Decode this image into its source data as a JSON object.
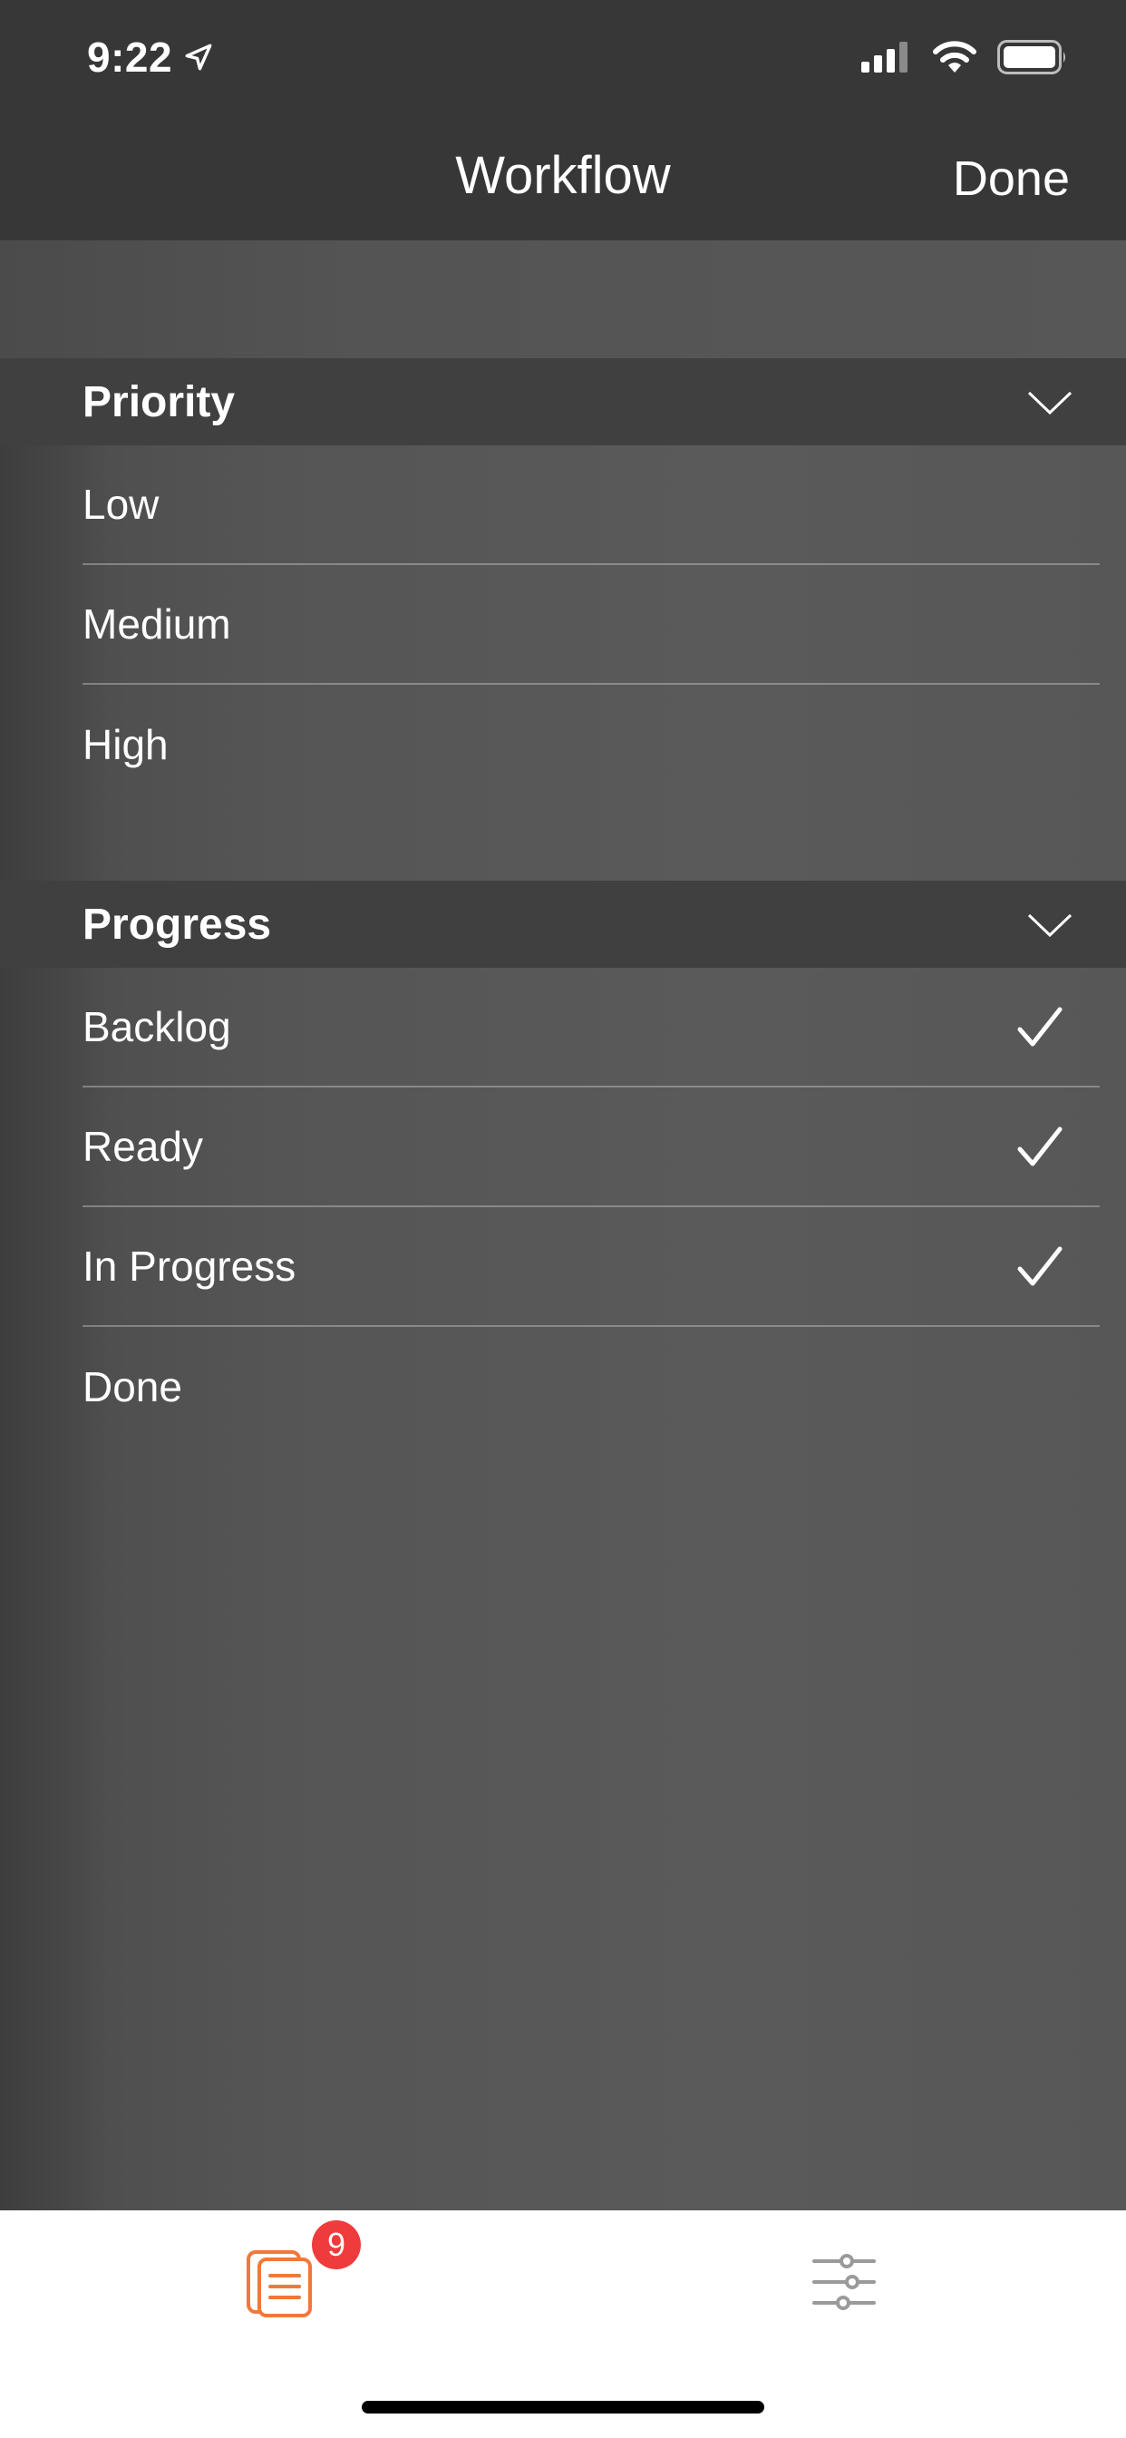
{
  "status_bar": {
    "time": "9:22",
    "icons": [
      "location-arrow-icon",
      "cellular-signal-icon",
      "wifi-icon",
      "battery-icon"
    ]
  },
  "nav": {
    "title": "Workflow",
    "done_label": "Done"
  },
  "sections": [
    {
      "title": "Priority",
      "items": [
        {
          "label": "Low",
          "checked": false
        },
        {
          "label": "Medium",
          "checked": false
        },
        {
          "label": "High",
          "checked": false
        }
      ]
    },
    {
      "title": "Progress",
      "items": [
        {
          "label": "Backlog",
          "checked": true
        },
        {
          "label": "Ready",
          "checked": true
        },
        {
          "label": "In Progress",
          "checked": true
        },
        {
          "label": "Done",
          "checked": false
        }
      ]
    }
  ],
  "tabbar": {
    "tasks_badge": "9",
    "accent_color": "#f0783c",
    "badge_color": "#ef3b3b",
    "icons": [
      "tasks-icon",
      "filter-sliders-icon"
    ]
  }
}
